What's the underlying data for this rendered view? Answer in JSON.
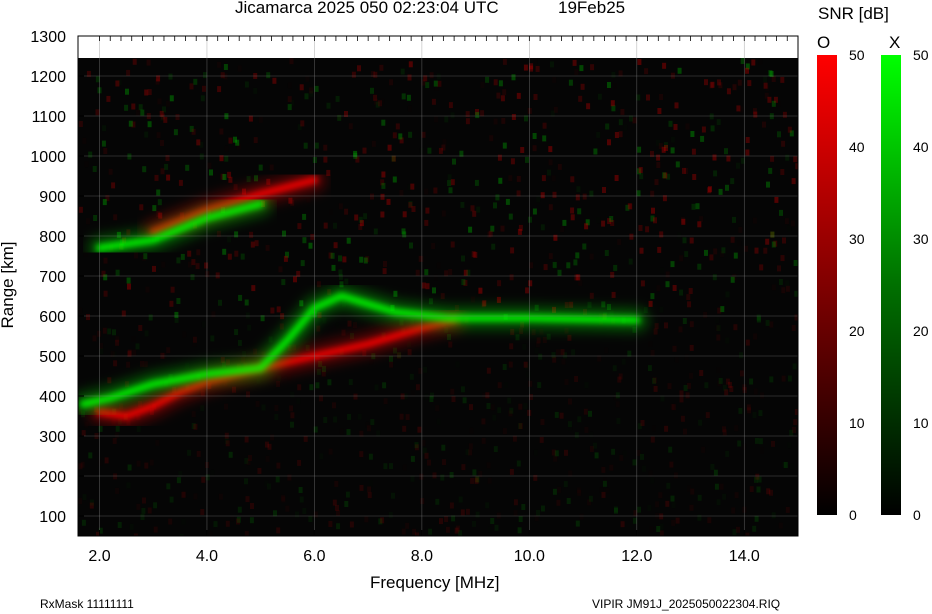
{
  "header": {
    "title": "Jicamarca 2025 050 02:23:04 UTC",
    "date": "19Feb25"
  },
  "colorbar": {
    "title": "SNR [dB]",
    "o_label": "O",
    "x_label": "X",
    "ticks": [
      "50",
      "40",
      "30",
      "20",
      "10",
      "0"
    ],
    "o_color": "#ff0000",
    "x_color": "#00ff00"
  },
  "footer": {
    "left": "RxMask 11111111",
    "right": "VIPIR  JM91J_2025050022304.RIQ"
  },
  "chart_data": {
    "type": "heatmap",
    "title": "Jicamarca 2025 050 02:23:04 UTC",
    "xlabel": "Frequency [MHz]",
    "ylabel": "Range [km]",
    "xlim": [
      1.6,
      15.0
    ],
    "ylim": [
      50,
      1300
    ],
    "x_ticks": [
      2.0,
      4.0,
      6.0,
      8.0,
      10.0,
      12.0,
      14.0
    ],
    "x_tick_labels": [
      "2.0",
      "4.0",
      "6.0",
      "8.0",
      "10.0",
      "12.0",
      "14.0"
    ],
    "y_ticks": [
      100,
      200,
      300,
      400,
      500,
      600,
      700,
      800,
      900,
      1000,
      1100,
      1200,
      1300
    ],
    "y_tick_labels": [
      "100",
      "200",
      "300",
      "400",
      "500",
      "600",
      "700",
      "800",
      "900",
      "1000",
      "1100",
      "1200",
      "1300"
    ],
    "grid": true,
    "colorscale_range_db": [
      0,
      50
    ],
    "traces": [
      {
        "mode": "O",
        "color": "#ff0000",
        "points": [
          [
            2.0,
            360
          ],
          [
            2.5,
            350
          ],
          [
            3.0,
            375
          ],
          [
            3.5,
            410
          ],
          [
            4.0,
            435
          ],
          [
            5.0,
            470
          ],
          [
            6.0,
            500
          ],
          [
            7.0,
            530
          ],
          [
            8.0,
            570
          ],
          [
            8.6,
            590
          ]
        ]
      },
      {
        "mode": "X",
        "color": "#00ff00",
        "points": [
          [
            1.7,
            380
          ],
          [
            2.2,
            395
          ],
          [
            3.0,
            430
          ],
          [
            4.0,
            455
          ],
          [
            5.0,
            470
          ],
          [
            5.5,
            540
          ],
          [
            6.0,
            620
          ],
          [
            6.5,
            650
          ],
          [
            7.5,
            610
          ],
          [
            8.5,
            595
          ],
          [
            10.0,
            595
          ],
          [
            12.0,
            590
          ]
        ]
      },
      {
        "mode": "O",
        "color": "#ff0000",
        "points": [
          [
            3.0,
            810
          ],
          [
            4.0,
            865
          ],
          [
            5.0,
            905
          ],
          [
            6.0,
            940
          ]
        ]
      },
      {
        "mode": "X",
        "color": "#00ff00",
        "points": [
          [
            2.0,
            770
          ],
          [
            3.0,
            790
          ],
          [
            4.0,
            845
          ],
          [
            5.0,
            880
          ]
        ]
      }
    ]
  }
}
